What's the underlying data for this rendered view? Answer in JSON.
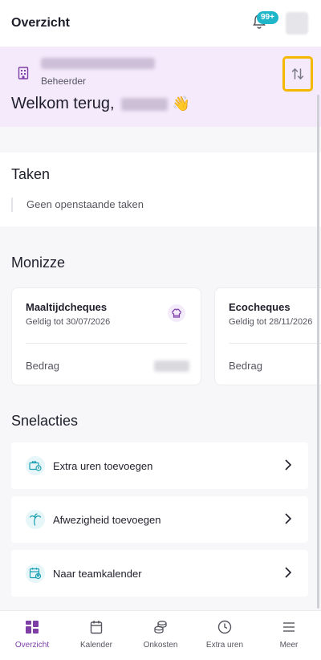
{
  "header": {
    "title": "Overzicht",
    "notification_count": "99+"
  },
  "welcome": {
    "role": "Beheerder",
    "greeting": "Welkom terug,",
    "emoji": "👋"
  },
  "tasks": {
    "title": "Taken",
    "empty_text": "Geen openstaande taken"
  },
  "monizze": {
    "title": "Monizze",
    "cards": [
      {
        "title": "Maaltijdcheques",
        "valid": "Geldig tot 30/07/2026",
        "amount_label": "Bedrag",
        "icon": "chef-hat-icon"
      },
      {
        "title": "Ecocheques",
        "valid": "Geldig tot 28/11/2026",
        "amount_label": "Bedrag",
        "icon": "leaf-icon"
      }
    ]
  },
  "quick_actions": {
    "title": "Snelacties",
    "items": [
      {
        "label": "Extra uren toevoegen",
        "icon": "briefcase-clock-icon"
      },
      {
        "label": "Afwezigheid toevoegen",
        "icon": "palm-tree-icon"
      },
      {
        "label": "Naar teamkalender",
        "icon": "calendar-user-icon"
      }
    ]
  },
  "bottom_nav": {
    "items": [
      {
        "label": "Overzicht",
        "icon": "dashboard-icon",
        "active": true
      },
      {
        "label": "Kalender",
        "icon": "calendar-icon",
        "active": false
      },
      {
        "label": "Onkosten",
        "icon": "coins-icon",
        "active": false
      },
      {
        "label": "Extra uren",
        "icon": "clock-icon",
        "active": false
      },
      {
        "label": "Meer",
        "icon": "menu-icon",
        "active": false
      }
    ]
  },
  "colors": {
    "accent": "#7d3ea6",
    "welcome_bg": "#f4eafb",
    "badge": "#1fb6c9",
    "highlight": "#f5b800"
  }
}
